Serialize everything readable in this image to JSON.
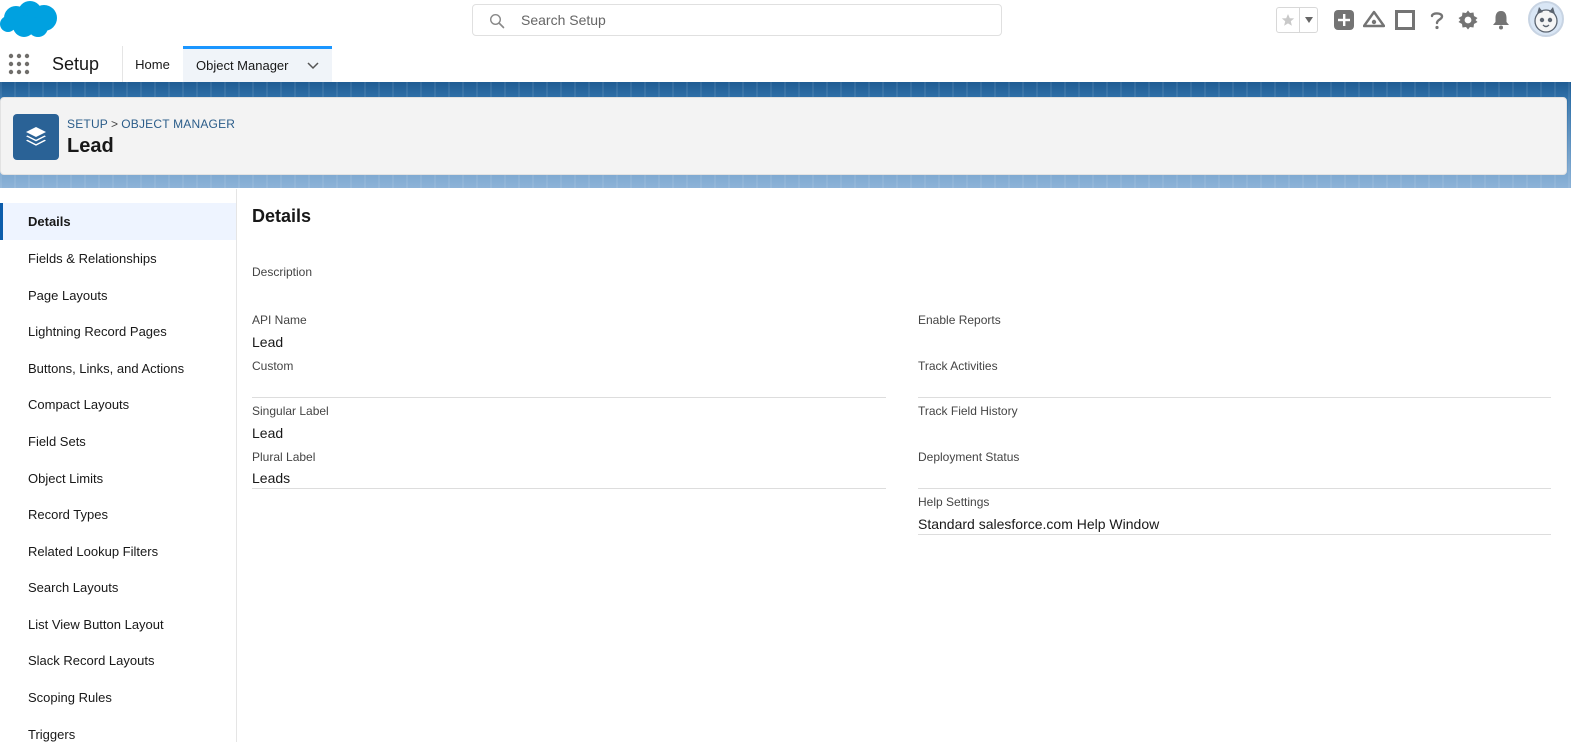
{
  "global": {
    "search_placeholder": "Search Setup"
  },
  "nav": {
    "app_name": "Setup",
    "tabs": [
      {
        "label": "Home"
      },
      {
        "label": "Object Manager"
      }
    ]
  },
  "header": {
    "breadcrumb": [
      "SETUP",
      ">",
      "OBJECT MANAGER"
    ],
    "title": "Lead"
  },
  "sidebar": {
    "items": [
      {
        "label": "Details"
      },
      {
        "label": "Fields & Relationships"
      },
      {
        "label": "Page Layouts"
      },
      {
        "label": "Lightning Record Pages"
      },
      {
        "label": "Buttons, Links, and Actions"
      },
      {
        "label": "Compact Layouts"
      },
      {
        "label": "Field Sets"
      },
      {
        "label": "Object Limits"
      },
      {
        "label": "Record Types"
      },
      {
        "label": "Related Lookup Filters"
      },
      {
        "label": "Search Layouts"
      },
      {
        "label": "List View Button Layout"
      },
      {
        "label": "Slack Record Layouts"
      },
      {
        "label": "Scoping Rules"
      },
      {
        "label": "Triggers"
      }
    ]
  },
  "details": {
    "title": "Details",
    "description_label": "Description",
    "left": [
      {
        "label": "API Name",
        "value": "Lead"
      },
      {
        "label": "Custom",
        "value": ""
      },
      {
        "label": "Singular Label",
        "value": "Lead"
      },
      {
        "label": "Plural Label",
        "value": "Leads"
      }
    ],
    "right": [
      {
        "label": "Enable Reports",
        "value": ""
      },
      {
        "label": "Track Activities",
        "value": ""
      },
      {
        "label": "Track Field History",
        "value": ""
      },
      {
        "label": "Deployment Status",
        "value": ""
      },
      {
        "label": "Help Settings",
        "value": "Standard salesforce.com Help Window"
      }
    ]
  },
  "colors": {
    "brand_blue": "#0b5cab",
    "tab_accent": "#1b96ff",
    "object_icon_bg": "#2a6296"
  }
}
